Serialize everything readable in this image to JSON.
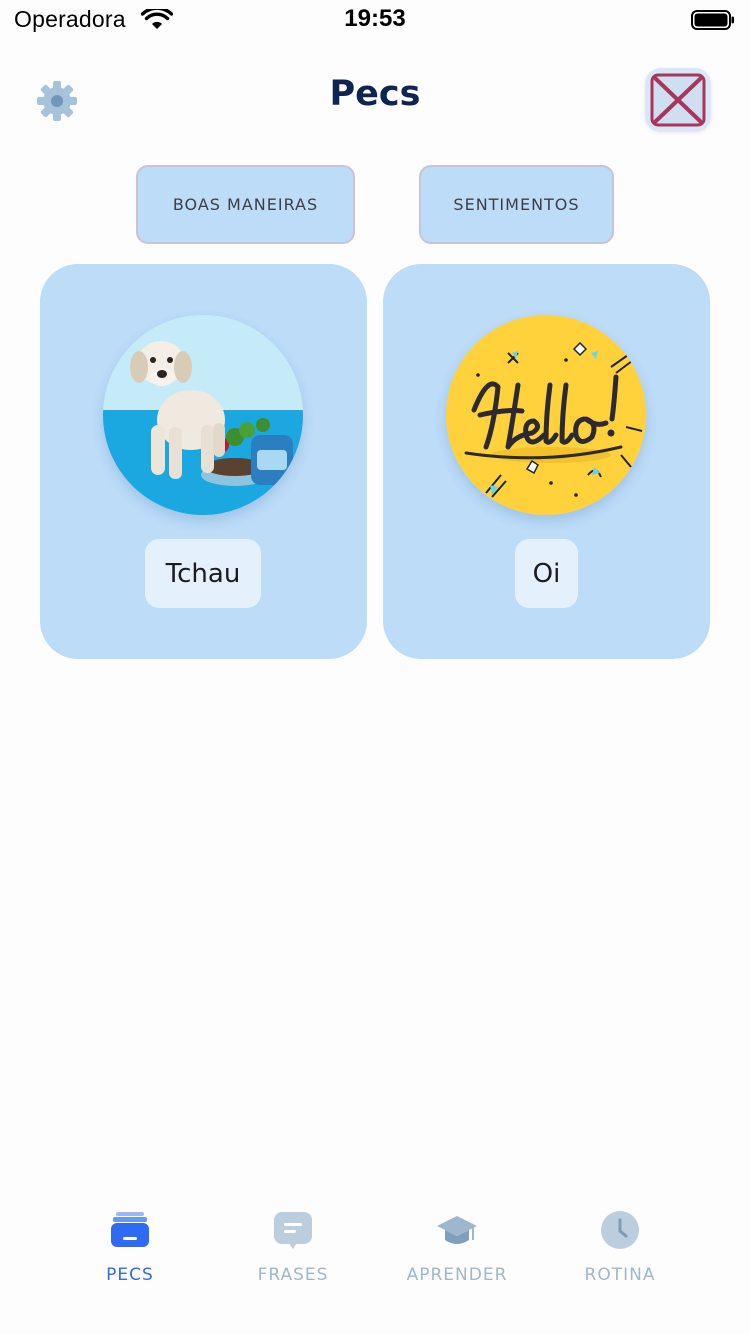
{
  "status_bar": {
    "carrier": "Operadora",
    "time": "19:53"
  },
  "header": {
    "title": "Pecs",
    "settings_icon": "gear-icon",
    "close_icon": "close-x-icon"
  },
  "categories": [
    {
      "label": "BOAS MANEIRAS"
    },
    {
      "label": "SENTIMENTOS"
    }
  ],
  "cards": [
    {
      "label": "Tchau",
      "image": "puppy-with-food-bowl"
    },
    {
      "label": "Oi",
      "image": "hello-lettering"
    }
  ],
  "tab_bar": {
    "active": "PECS",
    "tabs": [
      {
        "label": "PECS",
        "icon": "stack-icon"
      },
      {
        "label": "FRASES",
        "icon": "chat-bubble-icon"
      },
      {
        "label": "APRENDER",
        "icon": "graduation-cap-icon"
      },
      {
        "label": "ROTINA",
        "icon": "clock-icon"
      }
    ]
  },
  "colors": {
    "title": "#0f2450",
    "card_bg": "#bcdcf8",
    "label_bg": "#e4f0fc",
    "tab_active": "#2f6af2",
    "tab_inactive": "#9fb7cc"
  }
}
